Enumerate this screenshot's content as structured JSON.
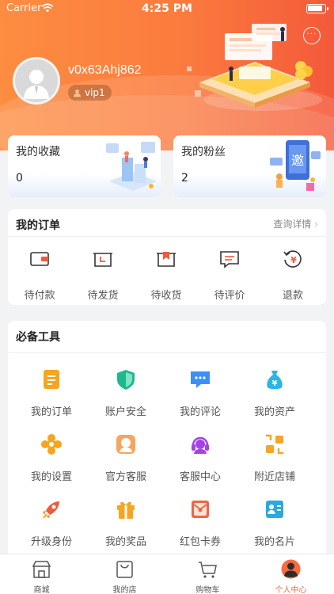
{
  "status_bar": {
    "carrier": "Carrier",
    "time": "4:25 PM"
  },
  "profile": {
    "username": "v0x63Ahj862",
    "vip_level": "vip1"
  },
  "cards": {
    "favorites": {
      "title": "我的收藏",
      "count": "0"
    },
    "fans": {
      "title": "我的粉丝",
      "count": "2"
    }
  },
  "orders": {
    "title": "我的订单",
    "more": "查询详情",
    "items": [
      {
        "label": "待付款",
        "icon": "wallet-icon"
      },
      {
        "label": "待发货",
        "icon": "clock-box-icon"
      },
      {
        "label": "待收货",
        "icon": "receive-box-icon"
      },
      {
        "label": "待评价",
        "icon": "comment-icon"
      },
      {
        "label": "退款",
        "icon": "refund-icon"
      }
    ]
  },
  "tools": {
    "title": "必备工具",
    "items": [
      {
        "label": "我的订单",
        "icon": "clipboard-icon",
        "color": "#f7a51e"
      },
      {
        "label": "账户安全",
        "icon": "shield-icon",
        "color": "#1cb98f"
      },
      {
        "label": "我的评论",
        "icon": "chat-icon",
        "color": "#3d8ff5"
      },
      {
        "label": "我的资产",
        "icon": "money-bag-icon",
        "color": "#29b5e8"
      },
      {
        "label": "我的设置",
        "icon": "flower-icon",
        "color": "#f7a51e"
      },
      {
        "label": "官方客服",
        "icon": "service-icon",
        "color": "#f7a55a"
      },
      {
        "label": "客服中心",
        "icon": "headset-icon",
        "color": "#a343e6"
      },
      {
        "label": "附近店铺",
        "icon": "location-icon",
        "color": "#f5a623"
      },
      {
        "label": "升级身份",
        "icon": "rocket-icon",
        "color": "#f05a3a"
      },
      {
        "label": "我的奖品",
        "icon": "gift-icon",
        "color": "#f7a51e"
      },
      {
        "label": "红包卡券",
        "icon": "red-envelope-icon",
        "color": "#f06445"
      },
      {
        "label": "我的名片",
        "icon": "card-icon",
        "color": "#2aa9e0"
      }
    ]
  },
  "tabbar": {
    "items": [
      {
        "label": "商城",
        "icon": "shop-icon"
      },
      {
        "label": "我的店",
        "icon": "bag-icon"
      },
      {
        "label": "购物车",
        "icon": "cart-icon"
      },
      {
        "label": "个人中心",
        "icon": "person-icon"
      }
    ],
    "active_color": "#fa6a3c"
  },
  "colors": {
    "header_start": "#fd8d41",
    "header_end": "#f4593a"
  }
}
